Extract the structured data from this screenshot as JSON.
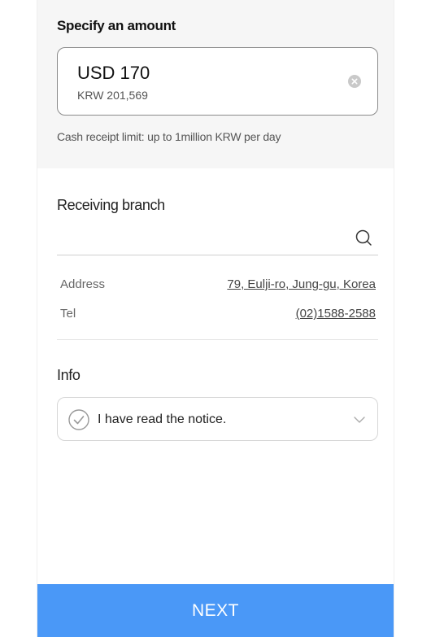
{
  "amount": {
    "title": "Specify an amount",
    "primary_value": "USD 170",
    "converted_value": "KRW 201,569",
    "limit_note": "Cash receipt limit: up to 1million KRW per day",
    "clear_icon": "clear-circle-icon"
  },
  "branch": {
    "title": "Receiving branch",
    "input_value": "",
    "search_icon": "search-icon",
    "address_label": "Address",
    "address_value": "79, Eulji-ro, Jung-gu, Korea",
    "tel_label": "Tel",
    "tel_value": "(02)1588-2588"
  },
  "info": {
    "title": "Info",
    "notice_label": "I have read the notice.",
    "check_icon": "check-circle-icon",
    "expand_icon": "chevron-down-icon"
  },
  "footer": {
    "next_label": "NEXT"
  },
  "colors": {
    "primary": "#4a98f7",
    "section_bg": "#f6f6f6"
  }
}
